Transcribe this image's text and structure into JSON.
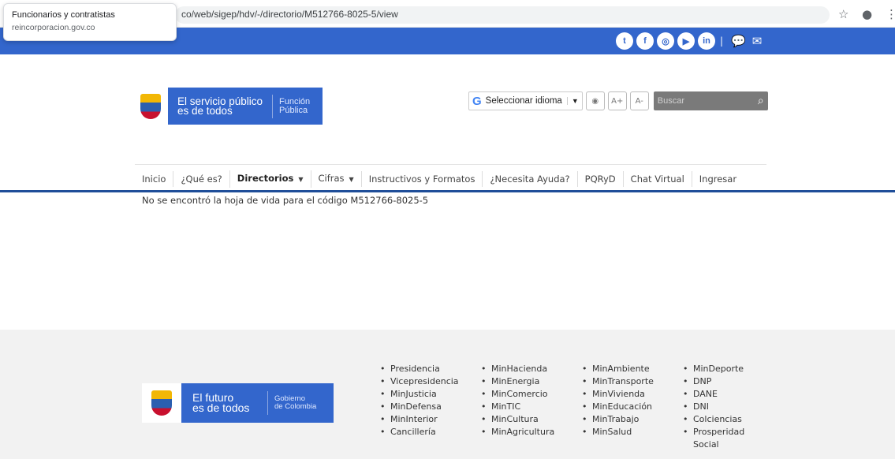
{
  "browser": {
    "url": "co/web/sigep/hdv/-/directorio/M512766-8025-5/view",
    "tooltip_title": "Funcionarios y contratistas",
    "tooltip_domain": "reincorporacion.gov.co"
  },
  "header": {
    "logo_line1": "El servicio público",
    "logo_line2": "es de todos",
    "logo_brand1": "Función",
    "logo_brand2": "Pública",
    "language_label": "Seleccionar idioma",
    "font_increase": "A+",
    "font_decrease": "A-",
    "search_placeholder": "Buscar"
  },
  "nav": {
    "items": [
      {
        "label": "Inicio"
      },
      {
        "label": "¿Qué es?"
      },
      {
        "label": "Directorios"
      },
      {
        "label": "Cifras"
      },
      {
        "label": "Instructivos y Formatos"
      },
      {
        "label": "¿Necesita Ayuda?"
      },
      {
        "label": "PQRyD"
      },
      {
        "label": "Chat Virtual"
      },
      {
        "label": "Ingresar"
      }
    ]
  },
  "main": {
    "message": "No se encontró la hoja de vida para el código M512766-8025-5"
  },
  "footer": {
    "logo_line1": "El futuro",
    "logo_line2": "es de todos",
    "logo_brand1": "Gobierno",
    "logo_brand2": "de Colombia",
    "columns": [
      [
        "Presidencia",
        "Vicepresidencia",
        "MinJusticia",
        "MinDefensa",
        "MinInterior",
        "Cancillería"
      ],
      [
        "MinHacienda",
        "MinEnergia",
        "MinComercio",
        "MinTIC",
        "MinCultura",
        "MinAgricultura"
      ],
      [
        "MinAmbiente",
        "MinTransporte",
        "MinVivienda",
        "MinEducación",
        "MinTrabajo",
        "MinSalud"
      ],
      [
        "MinDeporte",
        "DNP",
        "DANE",
        "DNI",
        "Colciencias",
        "Prosperidad Social"
      ]
    ]
  },
  "colors": {
    "brand_blue": "#3366cc",
    "nav_line": "#1f4e99",
    "footer_bg": "#f2f2f2"
  }
}
